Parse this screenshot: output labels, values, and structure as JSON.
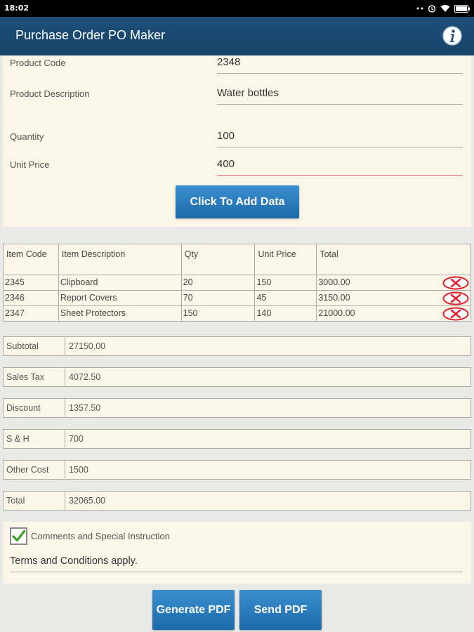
{
  "status_bar": {
    "time": "18:02"
  },
  "app": {
    "title": "Purchase Order PO Maker",
    "info_icon": "info-icon"
  },
  "form": {
    "product_code": {
      "label": "Product Code",
      "value": "2348"
    },
    "product_description": {
      "label": "Product Description",
      "value": "Water bottles"
    },
    "quantity": {
      "label": "Quantity",
      "value": "100"
    },
    "unit_price": {
      "label": "Unit Price",
      "value": "400"
    },
    "add_button": "Click To Add Data"
  },
  "items_table": {
    "headers": [
      "Item Code",
      "Item Description",
      "Qty",
      "Unit Price",
      "Total"
    ],
    "rows": [
      {
        "code": "2345",
        "description": "Clipboard",
        "qty": "20",
        "unit_price": "150",
        "total": "3000.00"
      },
      {
        "code": "2346",
        "description": "Report Covers",
        "qty": "70",
        "unit_price": "45",
        "total": "3150.00"
      },
      {
        "code": "2347",
        "description": "Sheet Protectors",
        "qty": "150",
        "unit_price": "140",
        "total": "21000.00"
      }
    ]
  },
  "summary": {
    "subtotal": {
      "label": "Subtotal",
      "value": "27150.00"
    },
    "sales_tax": {
      "label": "Sales Tax",
      "value": "4072.50"
    },
    "discount": {
      "label": "Discount",
      "value": "1357.50"
    },
    "shipping": {
      "label": "S & H",
      "value": "700"
    },
    "other_cost": {
      "label": "Other Cost",
      "value": "1500"
    },
    "total": {
      "label": "Total",
      "value": "32065.00"
    }
  },
  "comments": {
    "checkbox_label": "Comments and Special Instruction",
    "checked": true,
    "text": "Terms and Conditions apply."
  },
  "actions": {
    "generate_pdf": "Generate PDF",
    "send_pdf": "Send PDF"
  },
  "colors": {
    "app_bar": "#1d4e78",
    "panel": "#fbf6e7",
    "button": "#2a7dbf",
    "delete": "#e0202a",
    "check": "#3a9d2a"
  }
}
